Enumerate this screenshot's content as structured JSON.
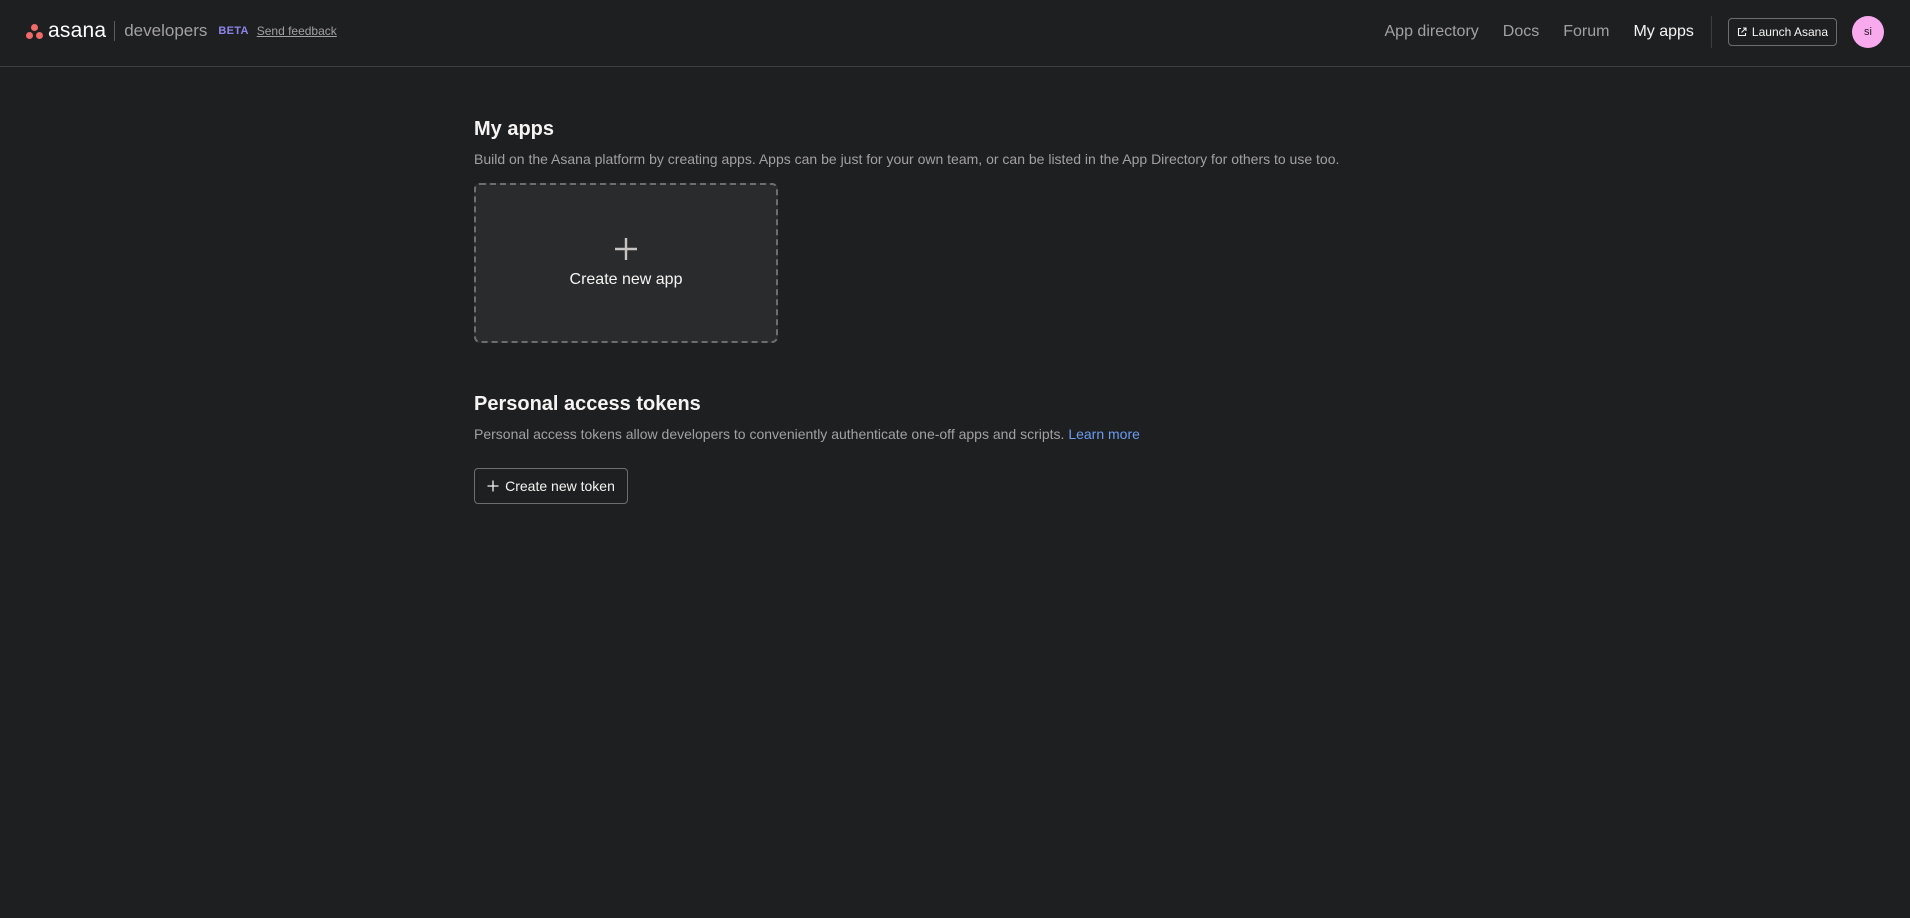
{
  "header": {
    "logo_text": "asana",
    "section": "developers",
    "badge": "BETA",
    "feedback_link": "Send feedback",
    "nav": [
      {
        "label": "App directory",
        "active": false
      },
      {
        "label": "Docs",
        "active": false
      },
      {
        "label": "Forum",
        "active": false
      },
      {
        "label": "My apps",
        "active": true
      }
    ],
    "launch_button": "Launch Asana",
    "launch_icon": "external-link-icon",
    "avatar_initials": "si",
    "avatar_color": "#f9aaef"
  },
  "my_apps": {
    "title": "My apps",
    "description": "Build on the Asana platform by creating apps. Apps can be just for your own team, or can be listed in the App Directory for others to use too.",
    "create_card_label": "Create new app",
    "create_card_icon": "plus-icon"
  },
  "tokens": {
    "title": "Personal access tokens",
    "description": "Personal access tokens allow developers to conveniently authenticate one-off apps and scripts.",
    "learn_more": "Learn more",
    "create_button": "Create new token",
    "create_button_icon": "plus-icon"
  },
  "colors": {
    "background": "#1e1f21",
    "brand_coral": "#f06a6a",
    "beta_purple": "#8d84e8",
    "link_blue": "#6a9cf0"
  }
}
